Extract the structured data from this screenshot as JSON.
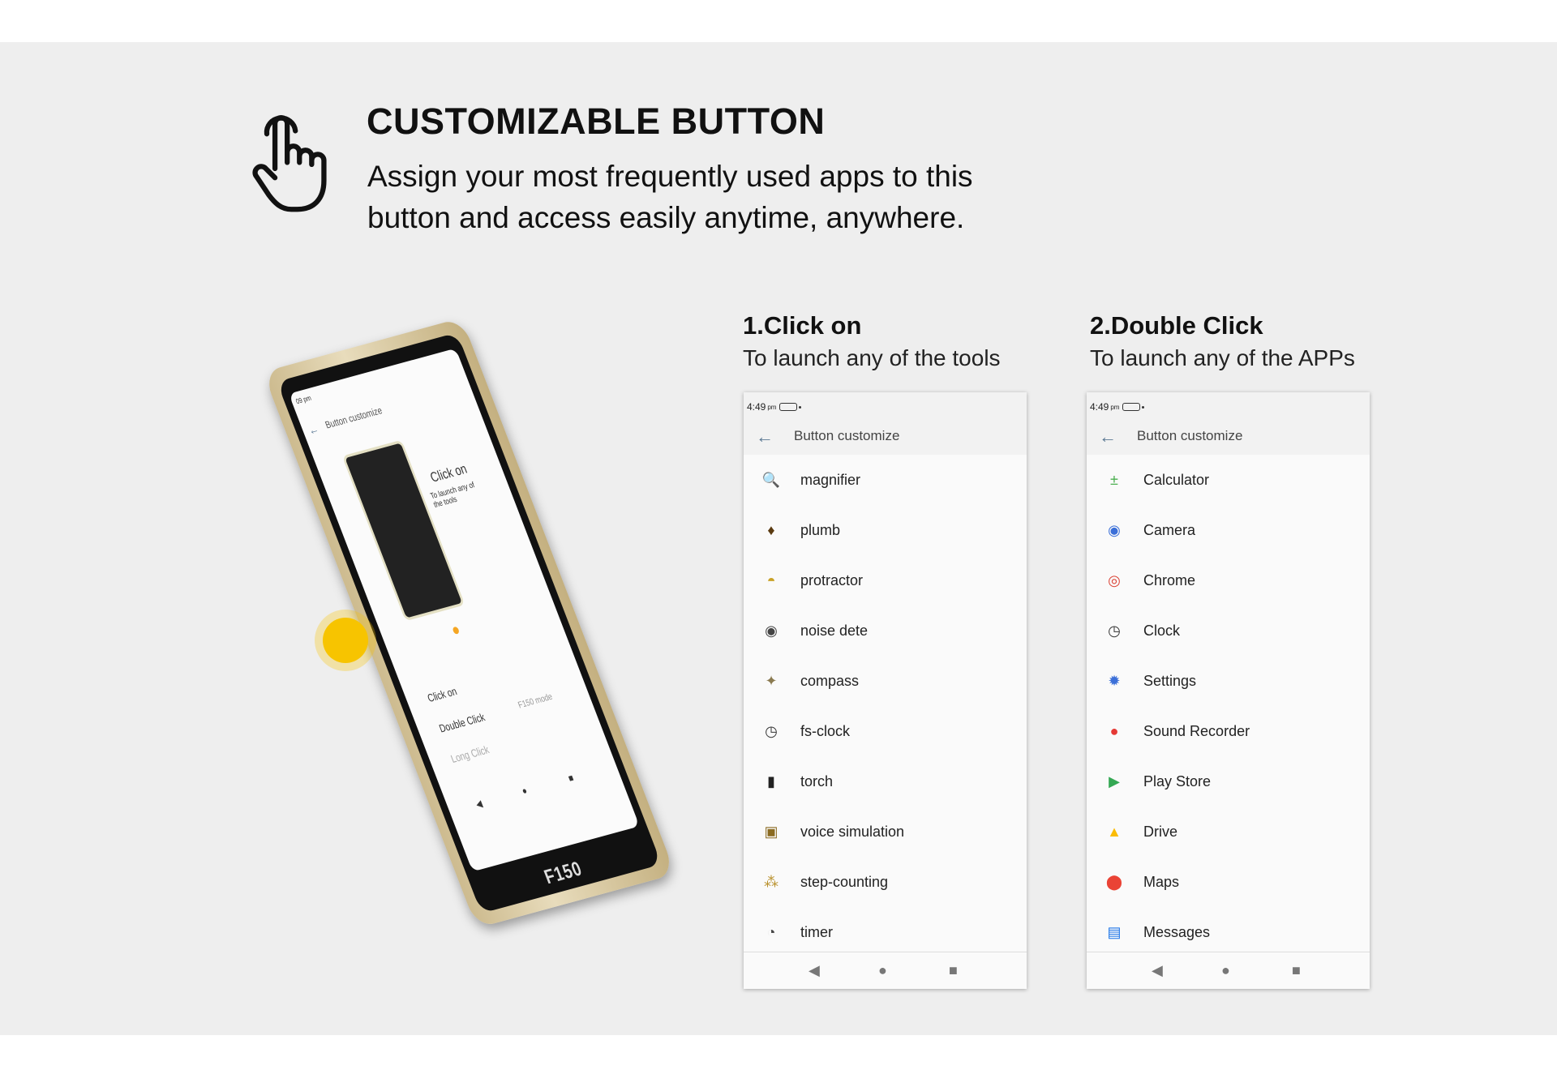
{
  "header": {
    "title": "CUSTOMIZABLE BUTTON",
    "subtitle_line1": "Assign your most frequently used apps to this",
    "subtitle_line2": "button and access easily anytime, anywhere.",
    "icon": "tap-hand-icon"
  },
  "phone": {
    "status_time": "09 pm",
    "screen_title": "Button customize",
    "promo_title": "Click on",
    "promo_sub": "To launch any of the tools",
    "rows": [
      "Click on",
      "Double Click",
      "Long Click"
    ],
    "double_click_value": "F150 mode",
    "brand": "F150",
    "accent": "#f7c400"
  },
  "step1": {
    "heading": "1.Click on",
    "subtitle": "To launch any of the tools",
    "time": "4:49",
    "ampm": "pm",
    "screen_title": "Button customize",
    "items": [
      {
        "label": "magnifier",
        "icon": "magnifier-icon"
      },
      {
        "label": "plumb",
        "icon": "plumb-icon"
      },
      {
        "label": "protractor",
        "icon": "protractor-icon"
      },
      {
        "label": "noise dete",
        "icon": "noise-meter-icon"
      },
      {
        "label": "compass",
        "icon": "compass-icon"
      },
      {
        "label": "fs-clock",
        "icon": "clock-icon"
      },
      {
        "label": "torch",
        "icon": "torch-icon"
      },
      {
        "label": "voice simulation",
        "icon": "voice-icon"
      },
      {
        "label": "step-counting",
        "icon": "footsteps-icon"
      },
      {
        "label": "timer",
        "icon": "timer-icon"
      }
    ]
  },
  "step2": {
    "heading": "2.Double Click",
    "subtitle": "To launch any of the APPs",
    "time": "4:49",
    "ampm": "pm",
    "screen_title": "Button customize",
    "items": [
      {
        "label": "Calculator",
        "icon": "calculator-icon"
      },
      {
        "label": "Camera",
        "icon": "camera-icon"
      },
      {
        "label": "Chrome",
        "icon": "chrome-icon"
      },
      {
        "label": "Clock",
        "icon": "clock-icon"
      },
      {
        "label": "Settings",
        "icon": "settings-icon"
      },
      {
        "label": "Sound Recorder",
        "icon": "recorder-icon"
      },
      {
        "label": "Play Store",
        "icon": "play-store-icon"
      },
      {
        "label": "Drive",
        "icon": "drive-icon"
      },
      {
        "label": "Maps",
        "icon": "maps-icon"
      },
      {
        "label": "Messages",
        "icon": "messages-icon"
      }
    ]
  }
}
